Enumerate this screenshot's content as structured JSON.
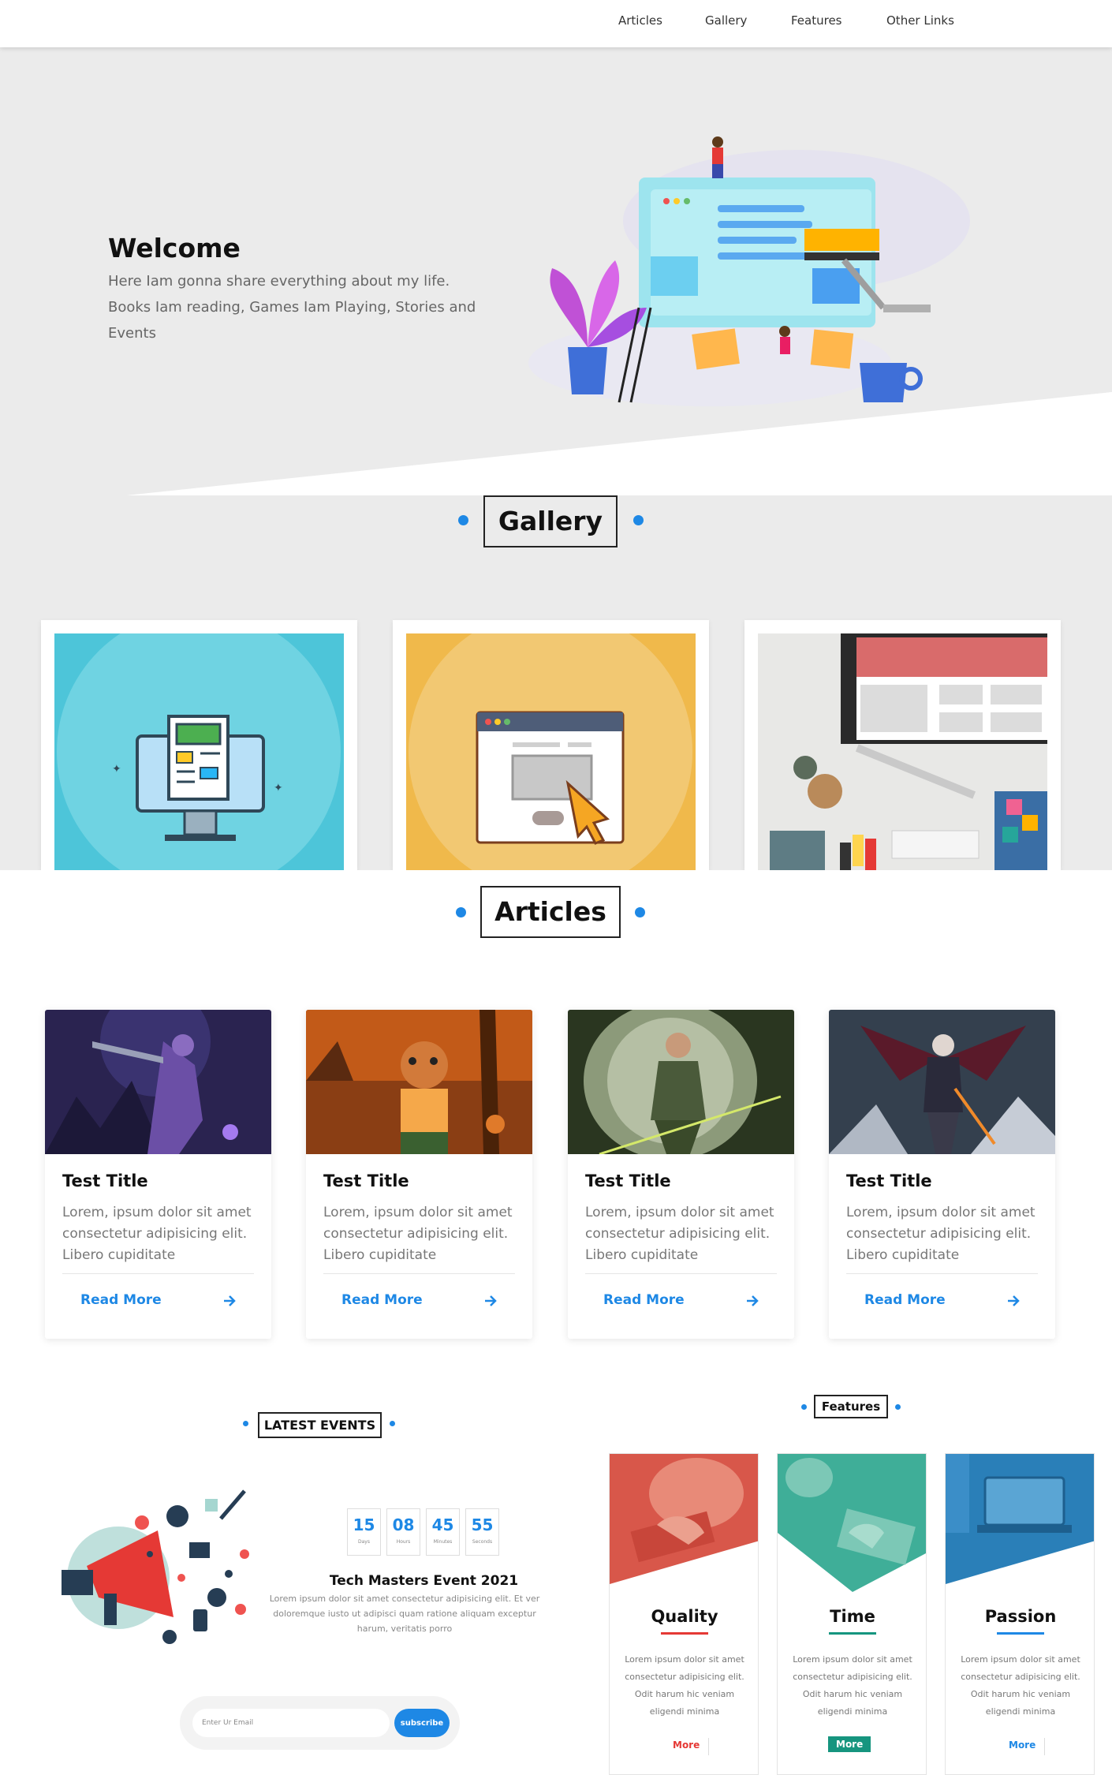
{
  "nav": {
    "items": [
      {
        "label": "Articles"
      },
      {
        "label": "Gallery"
      },
      {
        "label": "Features"
      },
      {
        "label": "Other Links"
      }
    ]
  },
  "hero": {
    "title": "Welcome",
    "text": "Here Iam gonna share everything about my life. Books Iam reading, Games Iam Playing, Stories and Events"
  },
  "gallery": {
    "title": "Gallery"
  },
  "articles": {
    "title": "Articles",
    "cards": [
      {
        "title": "Test Title",
        "desc": "Lorem, ipsum dolor sit amet consectetur adipisicing elit. Libero cupiditate",
        "link": "Read More"
      },
      {
        "title": "Test Title",
        "desc": "Lorem, ipsum dolor sit amet consectetur adipisicing elit. Libero cupiditate",
        "link": "Read More"
      },
      {
        "title": "Test Title",
        "desc": "Lorem, ipsum dolor sit amet consectetur adipisicing elit. Libero cupiditate",
        "link": "Read More"
      },
      {
        "title": "Test Title",
        "desc": "Lorem, ipsum dolor sit amet consectetur adipisicing elit. Libero cupiditate",
        "link": "Read More"
      }
    ]
  },
  "events": {
    "title": "LATEST EVENTS",
    "countdown": [
      {
        "value": "15",
        "label": "Days"
      },
      {
        "value": "08",
        "label": "Hours"
      },
      {
        "value": "45",
        "label": "Minutes"
      },
      {
        "value": "55",
        "label": "Seconds"
      }
    ],
    "event_name": "Tech Masters Event 2021",
    "event_desc": "Lorem ipsum dolor sit amet consectetur adipisicing elit. Et ver doloremque iusto ut adipisci quam ratione aliquam exceptur harum, veritatis porro",
    "email_placeholder": "Enter Ur Email",
    "subscribe_label": "subscribe"
  },
  "features": {
    "title": "Features",
    "cards": [
      {
        "title": "Quality",
        "desc": "Lorem ipsum dolor sit amet consectetur adipisicing elit. Odit harum hic veniam eligendi minima",
        "more": "More",
        "color": "#e53935"
      },
      {
        "title": "Time",
        "desc": "Lorem ipsum dolor sit amet consectetur adipisicing elit. Odit harum hic veniam eligendi minima",
        "more": "More",
        "color": "#16957f"
      },
      {
        "title": "Passion",
        "desc": "Lorem ipsum dolor sit amet consectetur adipisicing elit. Odit harum hic veniam eligendi minima",
        "more": "More",
        "color": "#1e88e5"
      }
    ]
  },
  "colors": {
    "accent": "#1e88e5",
    "hero_bg": "#ebebeb"
  }
}
